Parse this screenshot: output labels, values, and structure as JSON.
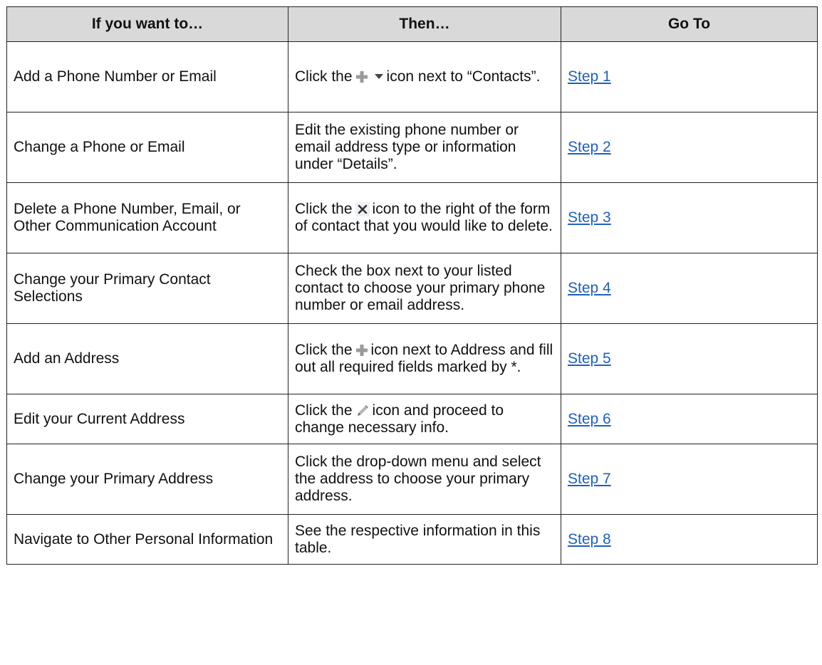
{
  "table": {
    "headers": {
      "want": "If you want to…",
      "then": "Then…",
      "goto": "Go To"
    },
    "rows": [
      {
        "want": "Add a Phone Number or Email",
        "then_before": "Click the",
        "icons": [
          "plus-icon",
          "dropdown-arrow-icon"
        ],
        "then_after": "icon next to “Contacts”.",
        "go_to": "Step 1"
      },
      {
        "want": "Change a Phone or Email",
        "then": "Edit the existing phone number or email address type or information under “Details”.",
        "go_to": "Step 2"
      },
      {
        "want": "Delete a Phone Number, Email, or Other Communication Account",
        "then_before": "Click the",
        "icons": [
          "close-x-icon"
        ],
        "then_after": "icon to the right of the form of contact that you would like to delete.",
        "go_to": "Step 3"
      },
      {
        "want": "Change your Primary Contact Selections",
        "then": "Check the box next to your listed contact to choose your primary phone number or email address.",
        "go_to": "Step 4"
      },
      {
        "want": "Add an Address",
        "then_before": "Click the",
        "icons": [
          "plus-icon"
        ],
        "then_after": "icon next to Address and fill out all required fields marked by *.",
        "go_to": "Step 5"
      },
      {
        "want": "Edit your Current Address",
        "then_before": "Click the",
        "icons": [
          "pencil-icon"
        ],
        "then_after": "icon and proceed to change necessary info.",
        "go_to": "Step 6"
      },
      {
        "want": "Change your Primary Address",
        "then": "Click the drop-down menu and select the address to choose your primary address.",
        "go_to": "Step 7"
      },
      {
        "want": "Navigate to Other Personal Information",
        "then": "See the respective information in this table.",
        "go_to": "Step 8"
      }
    ]
  },
  "colors": {
    "header_bg": "#d9d9d9",
    "border": "#222222",
    "link": "#1f5fbf",
    "icon_gray": "#9a9a9a"
  }
}
